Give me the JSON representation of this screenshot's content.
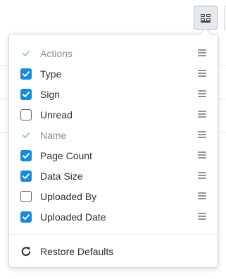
{
  "toolbar": {
    "columns_button_icon": "grid-columns-icon"
  },
  "menu": {
    "items": [
      {
        "label": "Actions",
        "checked": true,
        "disabled": true
      },
      {
        "label": "Type",
        "checked": true,
        "disabled": false
      },
      {
        "label": "Sign",
        "checked": true,
        "disabled": false
      },
      {
        "label": "Unread",
        "checked": false,
        "disabled": false
      },
      {
        "label": "Name",
        "checked": true,
        "disabled": true
      },
      {
        "label": "Page Count",
        "checked": true,
        "disabled": false
      },
      {
        "label": "Data Size",
        "checked": true,
        "disabled": false
      },
      {
        "label": "Uploaded By",
        "checked": false,
        "disabled": false
      },
      {
        "label": "Uploaded Date",
        "checked": true,
        "disabled": false
      }
    ],
    "restore_label": "Restore Defaults",
    "restore_icon": "refresh-icon",
    "drag_icon": "drag-handle-icon"
  },
  "colors": {
    "accent": "#1a8ad6",
    "accent_disabled": "#8fc6ec",
    "text": "#2b2f33",
    "text_disabled": "#8a9098"
  }
}
